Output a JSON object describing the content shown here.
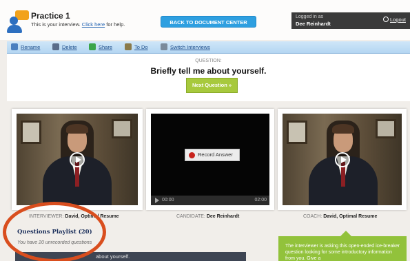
{
  "header": {
    "title": "Practice 1",
    "subtitle_prefix": "This is your interview.",
    "help_link": "Click here",
    "subtitle_suffix": "for help.",
    "back_button": "BACK TO DOCUMENT CENTER",
    "logged_in_label": "Logged in as",
    "user_name": "Dee Reinhardt",
    "logout": "Logout"
  },
  "toolbar": {
    "items": [
      {
        "label": "Rename",
        "icon": "pencil-icon",
        "color": "#4a7fbf"
      },
      {
        "label": "Delete",
        "icon": "delete-icon",
        "color": "#5a6d8a"
      },
      {
        "label": "Share",
        "icon": "share-icon",
        "color": "#3aa54a"
      },
      {
        "label": "To Do",
        "icon": "todo-icon",
        "color": "#8a7a4a"
      },
      {
        "label": "Switch Interviews",
        "icon": "switch-icon",
        "color": "#7a8a9a"
      }
    ]
  },
  "question": {
    "label": "QUESTION:",
    "text": "Briefly tell me about yourself.",
    "next_button": "Next Question »"
  },
  "videos": {
    "record_button": "Record Answer",
    "time_current": "00:00",
    "time_total": "02:00",
    "interviewer_role": "INTERVIEWER:",
    "interviewer_name": "David, Optimal Resume",
    "candidate_role": "CANDIDATE:",
    "candidate_name": "Dee Reinhardt",
    "coach_role": "COACH:",
    "coach_name": "David, Optimal Resume"
  },
  "playlist": {
    "title": "Questions Playlist (20)",
    "subtitle": "You have 20 unrecorded questions",
    "first_item": "about yourself."
  },
  "coach_tip": {
    "text": "The interviewer is asking this open-ended ice-breaker question looking for some introductory information from you. Give a"
  },
  "colors": {
    "accent_blue": "#2e9fe0",
    "next_green": "#a7c93d",
    "highlight_ring": "#d94e1e",
    "record_red": "#c8231d"
  }
}
